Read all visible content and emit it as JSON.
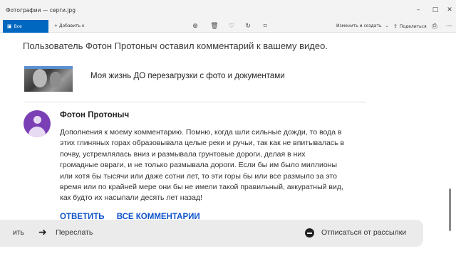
{
  "window": {
    "title": "Фотографии — серги.jpg",
    "minimize_glyph": "–",
    "maximize_glyph": "□",
    "close_glyph": "✕"
  },
  "toolbar": {
    "all_photos_label": "Все фотографии",
    "all_photos_icon": "image-icon",
    "add_to_label": "+ Добавить к",
    "edit_create_label": "Изменить и создать",
    "share_label": "Поделиться",
    "icons": [
      "zoom-icon",
      "delete-icon",
      "favorite-icon",
      "rotate-icon",
      "crop-icon",
      "print-icon",
      "more-icon"
    ]
  },
  "email": {
    "notification": "Пользователь Фотон Протоныч оставил комментарий к вашему видео.",
    "video_title": "Моя жизнь ДО перезагрузки с фото и документами",
    "author": "Фотон Протоныч",
    "comment_lines": [
      "Дополнения к моему комментарию. Помню, когда шли сильные дожди, то вода в",
      "этих глиняных горах образовывала целые реки и ручьи, так как не впитывалась в",
      "почву, устремлялась вниз и размывала грунтовые дороги, делая в них",
      "громадные овраги, и не только размывала дороги. Если бы им было миллионы",
      "или хотя бы тысячи или даже сотни лет, то эти горы бы или все размыло за это",
      "время или по крайней мере они бы не имели такой правильный, аккуратный вид,",
      "как будто их насыпали десять лет назад!"
    ],
    "reply_label": "ОТВЕТИТЬ",
    "all_comments_label": "ВСЕ КОММЕНТАРИИ"
  },
  "action_bar": {
    "partial_label": "ить",
    "forward_label": "Переслать",
    "unsubscribe_label": "Отписаться от рассылки"
  },
  "colors": {
    "accent": "#0067c0",
    "avatar": "#7b3fb5",
    "link": "#1155cc"
  }
}
